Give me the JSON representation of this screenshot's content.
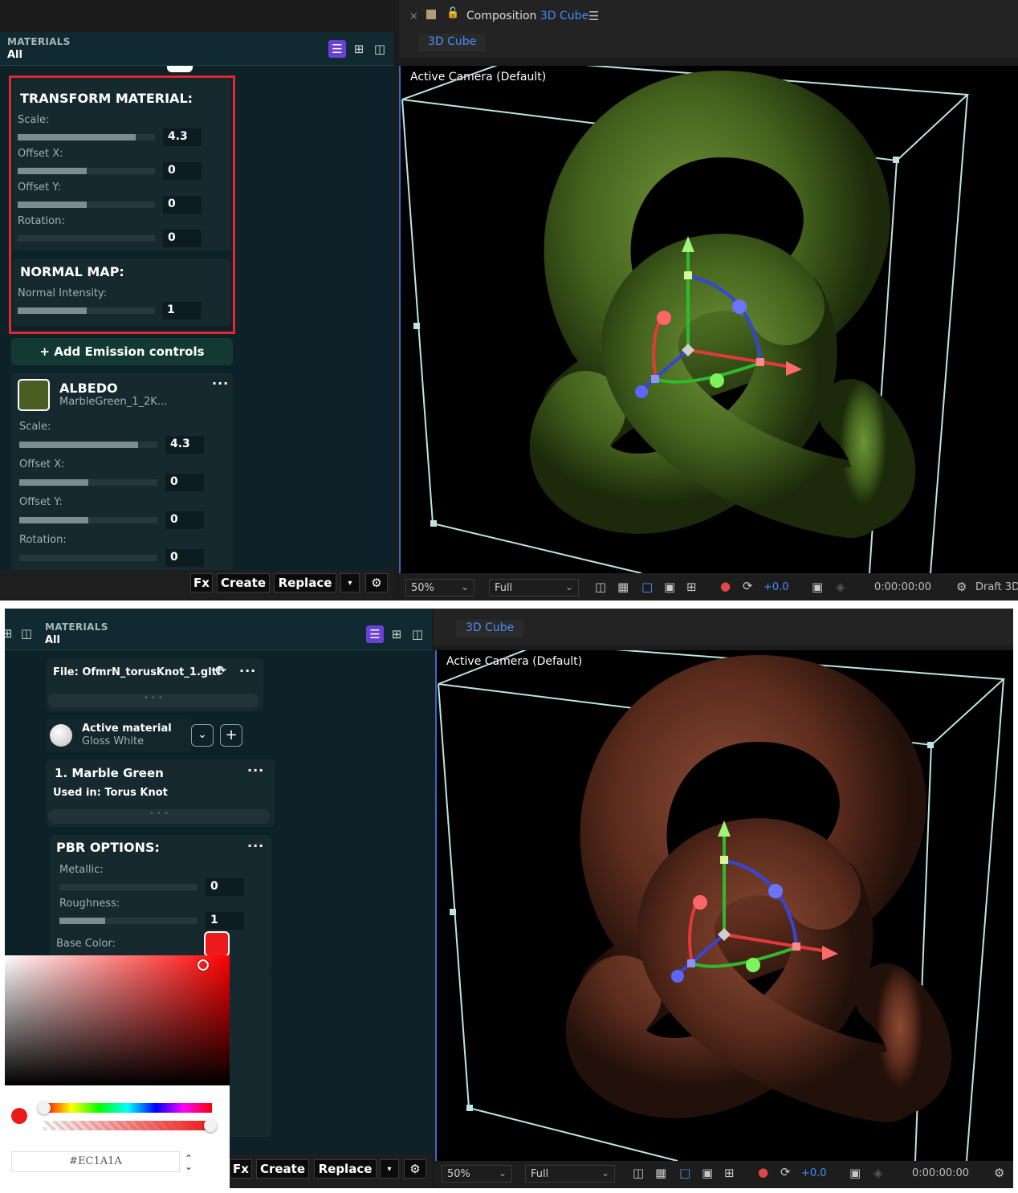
{
  "top": {
    "materials_panel": {
      "title": "MATERIALS",
      "subtitle": "All",
      "transform": {
        "title": "TRANSFORM MATERIAL:",
        "rows": [
          {
            "label": "Scale:",
            "value": "4.3",
            "level": 0.86
          },
          {
            "label": "Offset X:",
            "value": "0",
            "level": 0.5
          },
          {
            "label": "Offset Y:",
            "value": "0",
            "level": 0.5
          },
          {
            "label": "Rotation:",
            "value": "0",
            "level": 0.0
          }
        ]
      },
      "normal_map": {
        "title": "NORMAL MAP:",
        "label": "Normal Intensity:",
        "value": "1",
        "level": 0.5
      },
      "emission_button": "+ Add Emission controls",
      "albedo": {
        "title": "ALBEDO",
        "file": "MarbleGreen_1_2K...",
        "swatch_color": "#4a5e22",
        "rows": [
          {
            "label": "Scale:",
            "value": "4.3",
            "level": 0.86
          },
          {
            "label": "Offset X:",
            "value": "0",
            "level": 0.5
          },
          {
            "label": "Offset Y:",
            "value": "0",
            "level": 0.5
          },
          {
            "label": "Rotation:",
            "value": "0",
            "level": 0.0
          }
        ]
      },
      "toolbar": {
        "fx": "Fx",
        "create": "Create",
        "replace": "Replace"
      }
    },
    "composition": {
      "label": "Composition",
      "name": "3D Cube",
      "tab": "3D Cube",
      "camera": "Active Camera (Default)",
      "object_color": "#4d6e25"
    },
    "ae_bar": {
      "zoom": "50%",
      "resolution": "Full",
      "exposure": "+0.0",
      "timecode": "0:00:00:00",
      "renderer": "Draft 3D"
    }
  },
  "bottom": {
    "materials_panel": {
      "title": "MATERIALS",
      "subtitle": "All",
      "file": "File: OfmrN_torusKnot_1.gltf",
      "active_material": {
        "label": "Active material",
        "value": "Gloss White"
      },
      "material": {
        "name": "1. Marble Green",
        "used_in": "Used in: Torus Knot"
      },
      "pbr": {
        "title": "PBR OPTIONS:",
        "rows": [
          {
            "label": "Metallic:",
            "value": "0",
            "level": 0.0
          },
          {
            "label": "Roughness:",
            "value": "1",
            "level": 0.33
          }
        ],
        "base_color_label": "Base Color:",
        "base_color": "#EC1A1A"
      },
      "picker": {
        "hex": "#EC1A1A"
      },
      "toolbar": {
        "fx": "Fx",
        "create": "Create",
        "replace": "Replace"
      }
    },
    "composition": {
      "tab": "3D Cube",
      "camera": "Active Camera (Default)",
      "object_color": "#6a3524"
    },
    "ae_bar": {
      "zoom": "50%",
      "resolution": "Full",
      "exposure": "+0.0",
      "timecode": "0:00:00:00"
    }
  }
}
